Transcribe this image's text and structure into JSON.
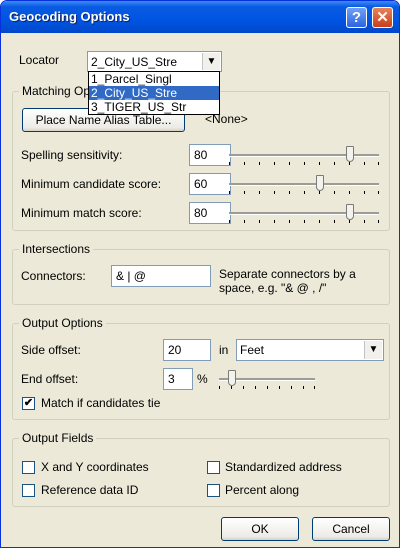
{
  "window": {
    "title": "Geocoding Options"
  },
  "locator": {
    "label": "Locator",
    "selected": "2_City_US_Stre",
    "options": [
      "1_Parcel_Singl",
      "2_City_US_Stre",
      "3_TIGER_US_Str"
    ]
  },
  "matching": {
    "title": "Matching Op",
    "alias_button": "Place Name Alias Table...",
    "alias_value": "<None>",
    "spelling_label": "Spelling sensitivity:",
    "spelling_value": "80",
    "min_candidate_label": "Minimum candidate score:",
    "min_candidate_value": "60",
    "min_match_label": "Minimum match score:",
    "min_match_value": "80"
  },
  "intersections": {
    "title": "Intersections",
    "connectors_label": "Connectors:",
    "connectors_value": "& | @",
    "hint_line1": "Separate connectors by a",
    "hint_line2": "space, e.g. \"& @ , /\""
  },
  "output_options": {
    "title": "Output Options",
    "side_offset_label": "Side offset:",
    "side_offset_value": "20",
    "in_label": "in",
    "units_value": "Feet",
    "end_offset_label": "End offset:",
    "end_offset_value": "3",
    "percent_label": "%",
    "match_tie_label": "Match if candidates tie",
    "match_tie_checked": true
  },
  "output_fields": {
    "title": "Output Fields",
    "xy_label": "X and Y coordinates",
    "std_address_label": "Standardized address",
    "ref_id_label": "Reference data ID",
    "percent_along_label": "Percent along"
  },
  "buttons": {
    "ok": "OK",
    "cancel": "Cancel"
  },
  "icons": {
    "check": "✔",
    "arrow": "▼"
  }
}
